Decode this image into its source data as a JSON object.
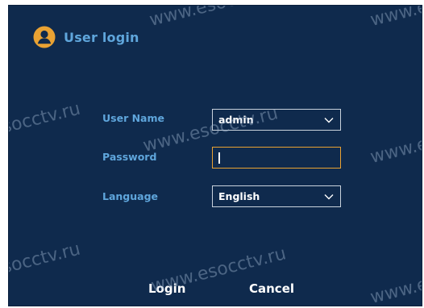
{
  "dialog": {
    "title": "User login",
    "icon": "user-avatar-icon"
  },
  "form": {
    "username_label": "User Name",
    "username_value": "admin",
    "password_label": "Password",
    "password_value": "",
    "language_label": "Language",
    "language_value": "English"
  },
  "actions": {
    "login_label": "Login",
    "cancel_label": "Cancel"
  },
  "watermarks": [
    "www.esocctv.ru",
    "esocctv.ru"
  ],
  "colors": {
    "background": "#0f2a4d",
    "label": "#5fa6dc",
    "field_border": "#c9d2dc",
    "focus_border": "#e9a233",
    "icon": "#e9a233",
    "button_text": "#ffffff"
  }
}
